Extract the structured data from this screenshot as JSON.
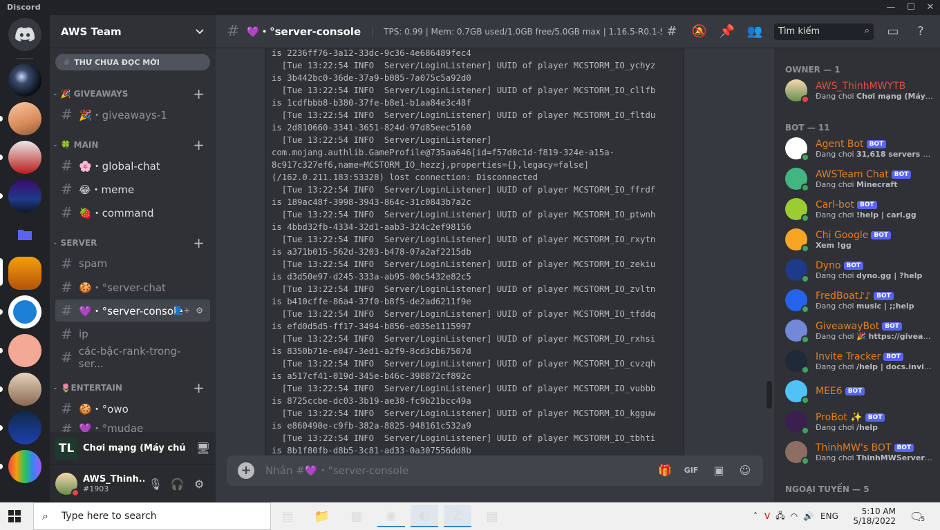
{
  "titlebar": {
    "app": "Discord",
    "min": "—",
    "max": "☐",
    "close": "✕"
  },
  "guild": {
    "name": "AWS Team",
    "unread_label": "THƯ CHƯA ĐỌC MỚI"
  },
  "categories": [
    {
      "label": "🎉 GIVEAWAYS",
      "channels": [
        "🎉・giveaways-1"
      ]
    },
    {
      "label": "🍀 MAIN",
      "channels": [
        "🌸・global-chat",
        "😂・meme",
        "🍓・command"
      ]
    },
    {
      "label": "SERVER",
      "channels": [
        "spam",
        "🍪・°server-chat",
        "💜・°server-console",
        "ip",
        "các-bậc-rank-trong-ser..."
      ]
    },
    {
      "label": "🌷ENTERTAIN",
      "channels": [
        "🍪・°owo",
        "💜・°mudae"
      ]
    }
  ],
  "activity": {
    "logo": "TL",
    "text": "Chơi mạng (Máy chủ b..."
  },
  "user": {
    "name": "AWS_Thinh...",
    "tag": "#1903"
  },
  "channel": {
    "name": "💜・°server-console",
    "topic": "TPS: 0.99 | Mem: 0.7GB used/1.0GB free/5.0GB max | 1.16.5-R0.1-S...",
    "search_placeholder": "Tìm kiếm",
    "composer_placeholder": "Nhắn #💜・°server-console"
  },
  "console_lines": [
    "is 2236ff76-3a12-33dc-9c36-4e686489fec4",
    "  [Tue 13:22:54 INFO  Server/LoginListener] UUID of player MCSTORM_IO_ychyz",
    "is 3b442bc0-36de-37a9-b085-7a075c5a92d0",
    "  [Tue 13:22:54 INFO  Server/LoginListener] UUID of player MCSTORM_IO_cllfb",
    "is 1cdfbbb8-b380-37fe-b8e1-b1aa84e3c48f",
    "  [Tue 13:22:54 INFO  Server/LoginListener] UUID of player MCSTORM_IO_fltdu",
    "is 2d810660-3341-3651-824d-97d85eec5160",
    "  [Tue 13:22:54 INFO  Server/LoginListener]",
    "com.mojang.authlib.GameProfile@735aa646[id=f57d0c1d-f819-324e-a15a-",
    "8c917c327ef6,name=MCSTORM_IO_hezzj,properties={},legacy=false]",
    "(/162.0.211.183:53328) lost connection: Disconnected",
    "  [Tue 13:22:54 INFO  Server/LoginListener] UUID of player MCSTORM_IO_ffrdf",
    "is 189ac48f-3998-3943-864c-31c0843b7a2c",
    "  [Tue 13:22:54 INFO  Server/LoginListener] UUID of player MCSTORM_IO_ptwnh",
    "is 4bbd32fb-4334-32d1-aab3-324c2ef98156",
    "  [Tue 13:22:54 INFO  Server/LoginListener] UUID of player MCSTORM_IO_rxytn",
    "is a371b015-562d-3203-b478-07a2af2215db",
    "  [Tue 13:22:54 INFO  Server/LoginListener] UUID of player MCSTORM_IO_zekiu",
    "is d3d50e97-d245-333a-ab95-00c5432e82c5",
    "  [Tue 13:22:54 INFO  Server/LoginListener] UUID of player MCSTORM_IO_zvltn",
    "is b410cffe-86a4-37f0-b8f5-de2ad6211f9e",
    "  [Tue 13:22:54 INFO  Server/LoginListener] UUID of player MCSTORM_IO_tfddq",
    "is efd0d5d5-ff17-3494-b856-e035e1115997",
    "  [Tue 13:22:54 INFO  Server/LoginListener] UUID of player MCSTORM_IO_rxhsi",
    "is 8350b71e-e047-3ed1-a2f9-8cd3cb67507d",
    "  [Tue 13:22:54 INFO  Server/LoginListener] UUID of player MCSTORM_IO_cvzqh",
    "is a517cf41-019d-345e-b46c-398872cf892c",
    "  [Tue 13:22:54 INFO  Server/LoginListener] UUID of player MCSTORM_IO_vubbb",
    "is 8725ccbe-dc03-3b19-ae38-fc9b21bcc49a",
    "  [Tue 13:22:54 INFO  Server/LoginListener] UUID of player MCSTORM_IO_kgguw",
    "is e860490e-c9fb-382a-8825-948161c532a9",
    "  [Tue 13:22:54 INFO  Server/LoginListener] UUID of player MCSTORM_IO_tbhti",
    "is 8b1f80fb-d8b5-3c81-ad33-0a307556dd8b"
  ],
  "members": {
    "owner_label": "OWNER — 1",
    "bot_label": "BOT — 11",
    "offline_label": "NGOẠI TUYẾN — 5",
    "owner": {
      "name": "AWS_ThinhMWYTB",
      "prefix": "Đang chơi ",
      "status": "Chơi mạng (Máy c..."
    },
    "bots": [
      {
        "name": "Agent Bot",
        "prefix": "Đang chơi ",
        "status": "31,618 servers | 2,8...",
        "color": "#ffffff"
      },
      {
        "name": "AWSTeam Chat",
        "prefix": "Đang chơi ",
        "status": "Minecraft",
        "color": "#43b581"
      },
      {
        "name": "Carl-bot",
        "prefix": "Đang chơi ",
        "status": "!help | carl.gg",
        "color": "#9acd32"
      },
      {
        "name": "Chị Google",
        "prefix": "",
        "status": "Xem !gg",
        "color": "#f6a623"
      },
      {
        "name": "Dyno",
        "prefix": "Đang chơi ",
        "status": "dyno.gg | ?help",
        "color": "#1e3a8a"
      },
      {
        "name": "FredBoat♪♪",
        "prefix": "Đang chơi ",
        "status": "music | ;;help",
        "color": "#2563eb"
      },
      {
        "name": "GiveawayBot",
        "prefix": "Đang chơi ",
        "status": "🎉 https://giveawa...",
        "color": "#7289da"
      },
      {
        "name": "Invite Tracker",
        "prefix": "Đang chơi ",
        "status": "/help | docs.invite-t...",
        "color": "#1f2937"
      },
      {
        "name": "MEE6",
        "prefix": "",
        "status": "",
        "color": "#4fc3f7"
      },
      {
        "name": "ProBot ✨",
        "prefix": "Đang chơi ",
        "status": "/help",
        "color": "#3b1f4f"
      },
      {
        "name": "ThinhMW's BOT",
        "prefix": "Đang chơi ",
        "status": "ThinhMWServerMi...",
        "color": "#8d6e63"
      }
    ],
    "bot_tag": "BOT"
  },
  "taskbar": {
    "search_placeholder": "Type here to search",
    "lang": "ENG",
    "time": "5:10 AM",
    "date": "5/18/2022",
    "notif_count": "5"
  }
}
